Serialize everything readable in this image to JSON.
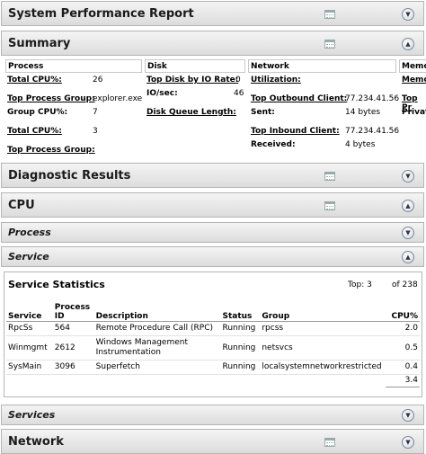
{
  "report": {
    "title": "System Performance Report"
  },
  "summary": {
    "title": "Summary",
    "process": {
      "header": "Process",
      "total_cpu_label": "Total CPU%:",
      "total_cpu_value": "26",
      "top_group_label": "Top Process Group:",
      "top_group_value": "explorer.exe",
      "group_cpu_label": "Group CPU%:",
      "group_cpu_value": "7",
      "total_cpu2_label": "Total CPU%:",
      "total_cpu2_value": "3",
      "top_group2_label": "Top Process Group:"
    },
    "disk": {
      "header": "Disk",
      "top_disk_label": "Top Disk by IO Rate:",
      "top_disk_value": "0",
      "io_label": "IO/sec:",
      "io_value": "46",
      "queue_label": "Disk Queue Length:"
    },
    "network": {
      "header": "Network",
      "util_label": "Utilization:",
      "out_label": "Top Outbound Client:",
      "out_value": "77.234.41.56",
      "sent_label": "Sent:",
      "sent_value": "14 bytes",
      "in_label": "Top Inbound Client:",
      "in_value": "77.234.41.56",
      "recv_label": "Received:",
      "recv_value": "4 bytes"
    },
    "memory": {
      "header": "Memo",
      "label1": "Memo",
      "label2": "Top Pr",
      "label3": "Private"
    }
  },
  "sections": {
    "diagnostic": "Diagnostic Results",
    "cpu": "CPU",
    "process": "Process",
    "service": "Service",
    "services": "Services",
    "network": "Network"
  },
  "service_stats": {
    "title": "Service Statistics",
    "top_label": "Top: 3",
    "of_label": "of 238",
    "columns": [
      "Service",
      "Process ID",
      "Description",
      "Status",
      "Group",
      "CPU%"
    ],
    "rows": [
      {
        "service": "RpcSs",
        "pid": "564",
        "description": "Remote Procedure Call (RPC)",
        "status": "Running",
        "group": "rpcss",
        "cpu": "2.0"
      },
      {
        "service": "Winmgmt",
        "pid": "2612",
        "description": "Windows Management Instrumentation",
        "status": "Running",
        "group": "netsvcs",
        "cpu": "0.5"
      },
      {
        "service": "SysMain",
        "pid": "3096",
        "description": "Superfetch",
        "status": "Running",
        "group": "localsystemnetworkrestricted",
        "cpu": "0.4"
      }
    ],
    "total": "3.4"
  },
  "icons": {
    "collapse": "chevron-up-icon",
    "expand": "chevron-down-icon",
    "report": "calendar-report-icon"
  }
}
